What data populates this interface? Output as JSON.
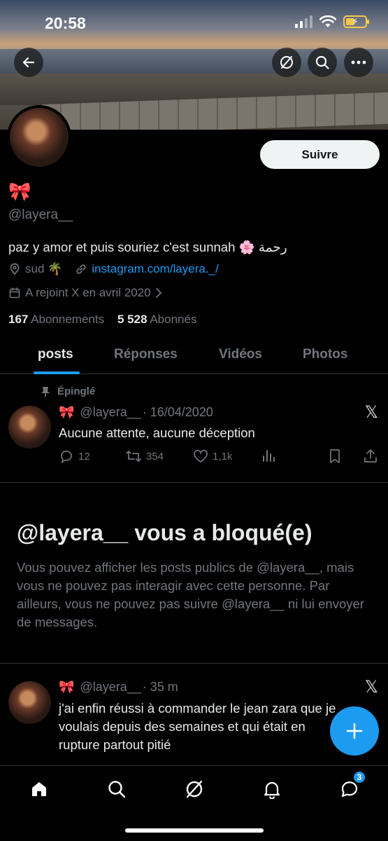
{
  "status_bar": {
    "time": "20:58"
  },
  "profile": {
    "emoji": "🎀",
    "handle": "@layera__",
    "follow_label": "Suivre",
    "bio": "paz y amor et puis souriez c'est sunnah 🌸 رحمة",
    "location": "sud 🌴",
    "website": "instagram.com/layera._/",
    "joined": "A rejoint X en avril 2020",
    "following_count": "167",
    "following_label": "Abonnements",
    "followers_count": "5 528",
    "followers_label": "Abonnés"
  },
  "tabs": [
    {
      "label": "posts",
      "active": true
    },
    {
      "label": "Réponses",
      "active": false
    },
    {
      "label": "Vidéos",
      "active": false
    },
    {
      "label": "Photos",
      "active": false
    }
  ],
  "pinned_post": {
    "pinned_label": "Épinglé",
    "emoji": "🎀",
    "handle": "@layera__",
    "date": "· 16/04/2020",
    "text": "Aucune attente, aucune déception",
    "replies": "12",
    "reposts": "354",
    "likes": "1,1k"
  },
  "blocked": {
    "title": "@layera__ vous a bloqué(e)",
    "text": "Vous pouvez afficher les posts publics de @layera__, mais vous ne pouvez pas interagir avec cette personne. Par ailleurs, vous ne pouvez pas suivre @layera__ ni lui envoyer de messages."
  },
  "recent_post": {
    "emoji": "🎀",
    "handle": "@layera__",
    "date": "· 35 m",
    "text": "j'ai enfin réussi à commander le jean zara que je voulais depuis des semaines et qui était en rupture partout pitié"
  },
  "bottom_nav": {
    "messages_badge": "3"
  },
  "colors": {
    "accent": "#1d9bf0",
    "background": "#000000",
    "muted": "#71767b"
  }
}
